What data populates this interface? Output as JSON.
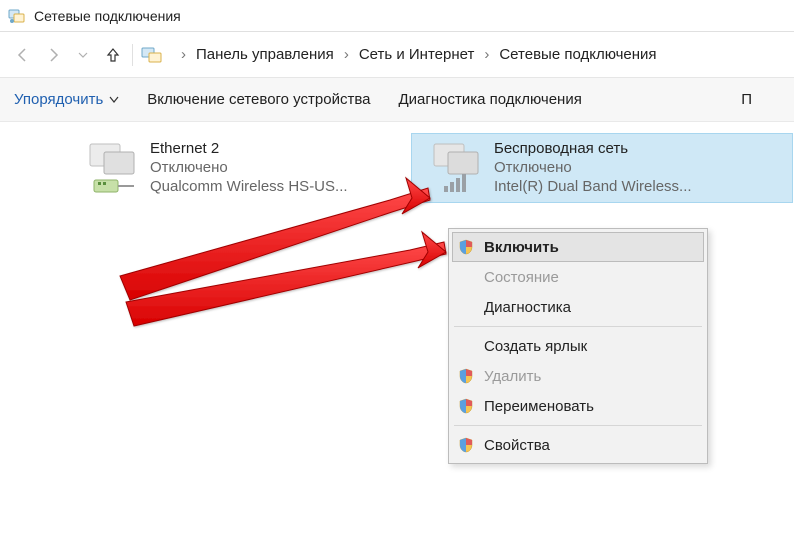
{
  "window": {
    "title": "Сетевые подключения"
  },
  "breadcrumb": {
    "items": [
      "Панель управления",
      "Сеть и Интернет",
      "Сетевые подключения"
    ]
  },
  "toolbar": {
    "organize": "Упорядочить",
    "enable_device": "Включение сетевого устройства",
    "diagnose": "Диагностика подключения",
    "overflow": "П"
  },
  "connections": [
    {
      "name": "Ethernet 2",
      "status": "Отключено",
      "device": "Qualcomm Wireless HS-US...",
      "selected": false,
      "type": "ethernet"
    },
    {
      "name": "Беспроводная сеть",
      "status": "Отключено",
      "device": "Intel(R) Dual Band Wireless...",
      "selected": true,
      "type": "wifi"
    }
  ],
  "context_menu": {
    "items": [
      {
        "label": "Включить",
        "shield": true,
        "bold": true,
        "hover": true
      },
      {
        "label": "Состояние",
        "disabled": true
      },
      {
        "label": "Диагностика"
      },
      {
        "sep": true
      },
      {
        "label": "Создать ярлык"
      },
      {
        "label": "Удалить",
        "shield": true,
        "disabled": true
      },
      {
        "label": "Переименовать",
        "shield": true
      },
      {
        "sep": true
      },
      {
        "label": "Свойства",
        "shield": true
      }
    ]
  }
}
